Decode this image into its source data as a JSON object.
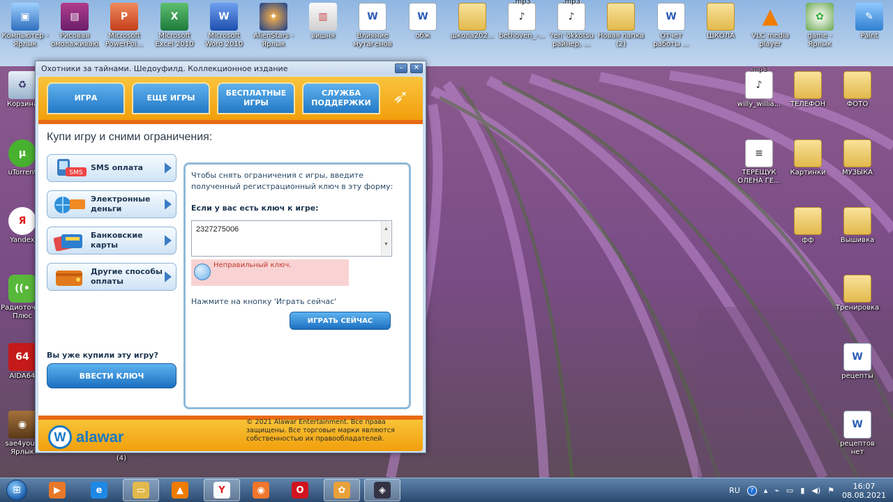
{
  "desktop": {
    "top_icons": [
      {
        "label": "Компьютер - Ярлык",
        "icon": "computer-icon"
      },
      {
        "label": "Рисовая омолаживающ...",
        "icon": "winrar-icon"
      },
      {
        "label": "Microsoft PowerPoi...",
        "icon": "powerpoint-icon"
      },
      {
        "label": "Microsoft Excel 2010",
        "icon": "excel-icon"
      },
      {
        "label": "Microsoft Word 2010",
        "icon": "word-icon"
      },
      {
        "label": "AlienStars - Ярлык",
        "icon": "alienstars-icon"
      },
      {
        "label": "вишня",
        "icon": "presentation-icon"
      },
      {
        "label": "Влияние мутагенов ...",
        "icon": "word-doc-icon"
      },
      {
        "label": "обж",
        "icon": "word-doc-icon"
      },
      {
        "label": "школа202...",
        "icon": "folder-icon"
      },
      {
        "label": "bethoven_-...",
        "icon": "mp3-icon",
        "badge": ".mp3"
      },
      {
        "label": "'ren 'okkotsu райнер, ...",
        "icon": "mp3-icon",
        "badge": ".mp3"
      },
      {
        "label": "Новая папка (2)",
        "icon": "folder-icon"
      },
      {
        "label": "Отчет работы ...",
        "icon": "word-doc-icon"
      },
      {
        "label": "ШКОЛА",
        "icon": "folder-icon"
      },
      {
        "label": "VLC media player",
        "icon": "vlc-icon"
      },
      {
        "label": "game - Ярлык",
        "icon": "game-icon"
      },
      {
        "label": "Paint",
        "icon": "paint-icon"
      }
    ],
    "left_icons": [
      {
        "label": "Корзина",
        "icon": "recycle-bin-icon"
      },
      {
        "label": "uTorrent",
        "icon": "utorrent-icon"
      },
      {
        "label": "Yandex",
        "icon": "yandex-icon"
      },
      {
        "label": "Радиоточка Плюс",
        "icon": "radio-icon"
      },
      {
        "label": "AIDA64",
        "icon": "aida64-icon"
      },
      {
        "label": "sae4you - Ярлык",
        "icon": "sae4you-icon"
      }
    ],
    "right_icons": [
      {
        "label": "willy_willia...",
        "icon": "mp3-icon",
        "badge": ".mp3"
      },
      {
        "label": "ТЕЛЕФОН",
        "icon": "folder-icon"
      },
      {
        "label": "ФОТО",
        "icon": "folder-icon"
      },
      {
        "label": "ТЕРЕЩУК ОЛЕНА ГЕ...",
        "icon": "document-icon"
      },
      {
        "label": "Картинки",
        "icon": "folder-icon"
      },
      {
        "label": "МУЗЫКА",
        "icon": "folder-icon"
      },
      {
        "label": "фф",
        "icon": "folder-icon"
      },
      {
        "label": "Вышивка",
        "icon": "folder-icon"
      },
      {
        "label": "Тренировка",
        "icon": "folder-icon"
      },
      {
        "label": "рецепты",
        "icon": "word-doc-icon"
      },
      {
        "label": "рецептов нет",
        "icon": "word-doc-icon"
      }
    ],
    "hidden_label_fragment": "(4)"
  },
  "window": {
    "title": "Охотники за тайнами. Шедоуфилд. Коллекционное издание",
    "minimize": "–",
    "close": "✕",
    "tabs": [
      "ИГРА",
      "ЕЩЕ ИГРЫ",
      "БЕСПЛАТНЫЕ ИГРЫ",
      "СЛУЖБА ПОДДЕРЖКИ"
    ],
    "heading": "Купи игру и сними ограничения:",
    "payment_options": [
      {
        "label": "SMS оплата",
        "icon": "sms-icon"
      },
      {
        "label": "Электронные деньги",
        "icon": "e-money-icon"
      },
      {
        "label": "Банковские карты",
        "icon": "bank-cards-icon"
      },
      {
        "label": "Другие способы оплаты",
        "icon": "wallet-icon"
      }
    ],
    "already_bought": "Вы уже купили эту игру?",
    "enter_key_button": "ВВЕСТИ КЛЮЧ",
    "key_panel": {
      "intro": "Чтобы снять ограничения с игры, введите полученный регистрационный ключ в эту форму:",
      "question": "Если у вас есть ключ к игре:",
      "key_value": "2327275006",
      "error": "Неправильный ключ.",
      "hint": "Нажмите на кнопку 'Играть сейчас'",
      "play_button": "ИГРАТЬ СЕЙЧАС"
    },
    "footer": {
      "brand": "alawar",
      "copyright": "© 2021 Alawar Entertainment. Все права защищены. Все торговые марки являются собственностью их правообладателей."
    }
  },
  "taskbar": {
    "apps": [
      {
        "name": "media-player",
        "active": false
      },
      {
        "name": "internet-explorer",
        "active": false
      },
      {
        "name": "explorer",
        "active": true
      },
      {
        "name": "vlc",
        "active": false
      },
      {
        "name": "yandex",
        "active": true
      },
      {
        "name": "firefox",
        "active": false
      },
      {
        "name": "opera",
        "active": false
      },
      {
        "name": "butterfly-app",
        "active": true
      },
      {
        "name": "alawar-game",
        "active": true
      }
    ],
    "language": "RU",
    "time": "16:07",
    "date": "08.08.2021"
  }
}
